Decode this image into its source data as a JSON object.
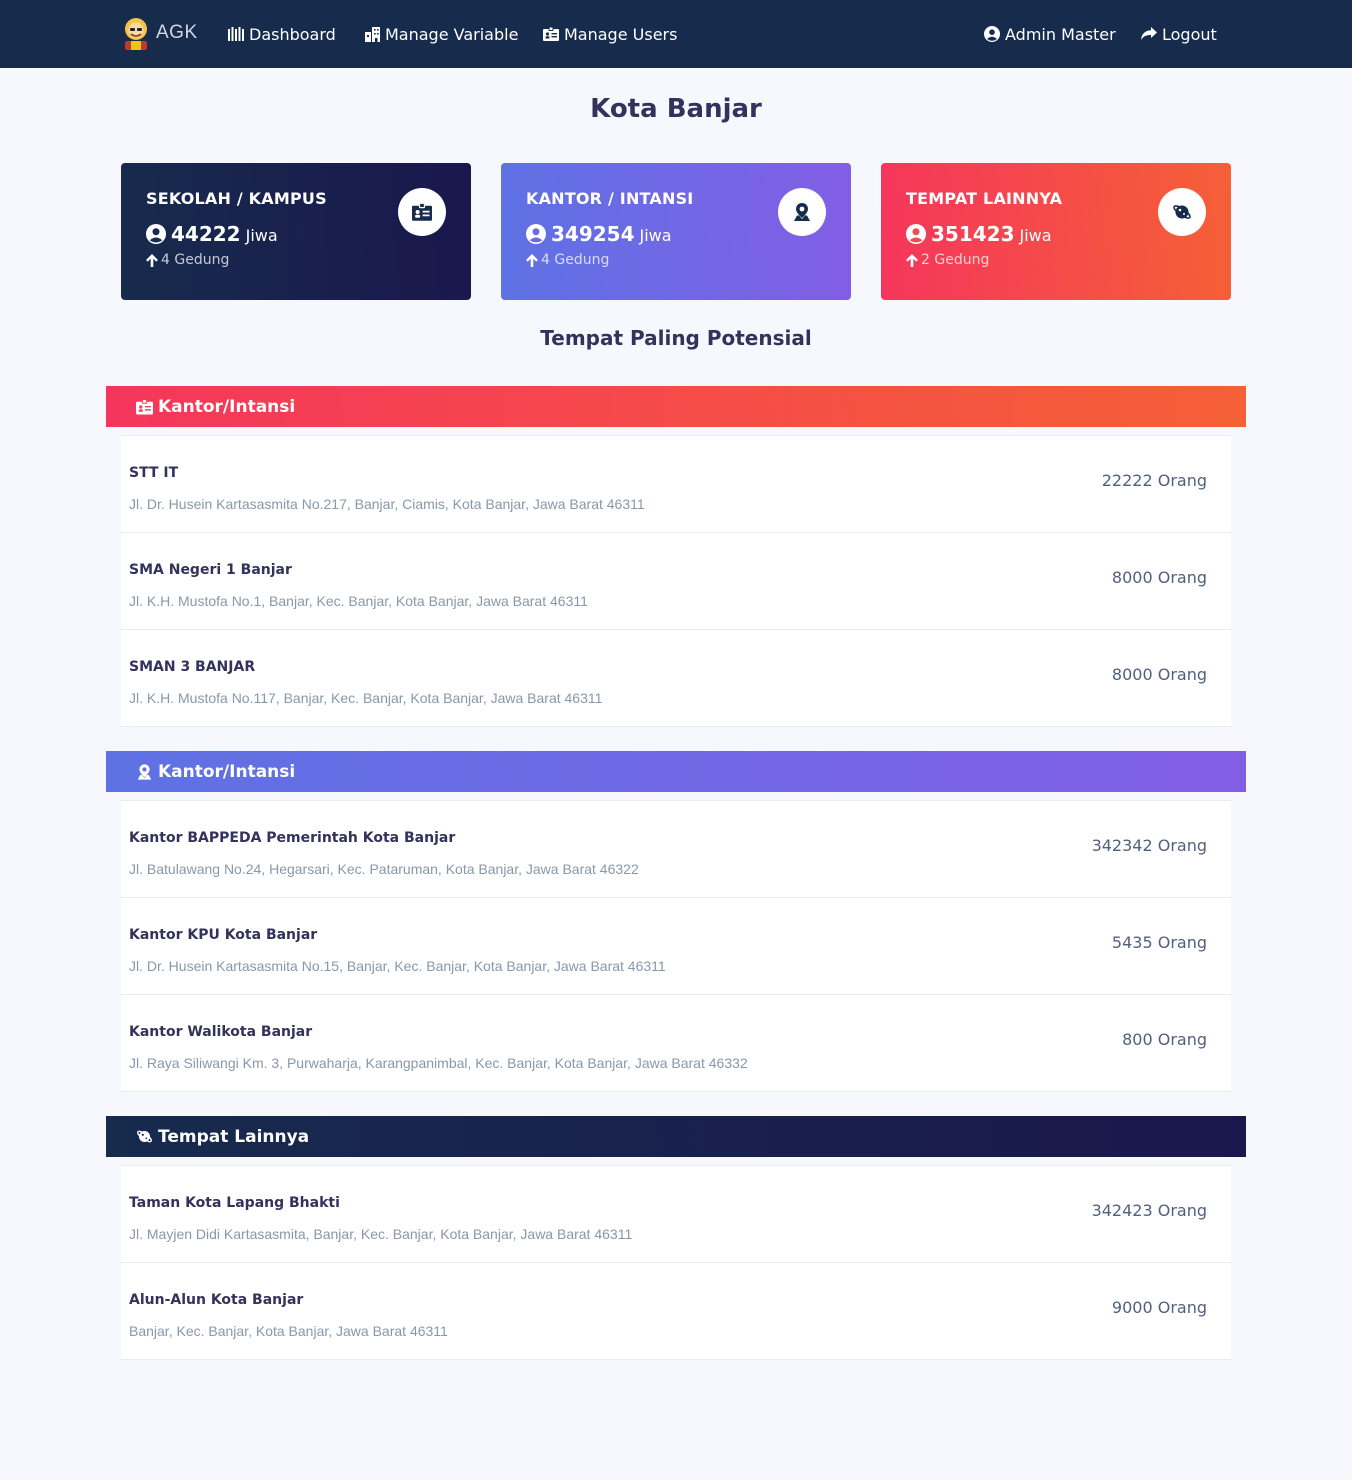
{
  "nav": {
    "brand": "AGK",
    "links": [
      {
        "label": "Dashboard",
        "icon": "chart-bars-icon"
      },
      {
        "label": "Manage Variable",
        "icon": "building-icon"
      },
      {
        "label": "Manage Users",
        "icon": "badge-icon"
      }
    ],
    "user": "Admin Master",
    "logout": "Logout"
  },
  "page_title": "Kota Banjar",
  "stats": [
    {
      "title": "SEKOLAH / KAMPUS",
      "value": "44222",
      "unit": "Jiwa",
      "sub": "4 Gedung",
      "icon": "badge-icon"
    },
    {
      "title": "KANTOR / INTANSI",
      "value": "349254",
      "unit": "Jiwa",
      "sub": "4 Gedung",
      "icon": "map-pin-icon"
    },
    {
      "title": "TEMPAT LAINNYA",
      "value": "351423",
      "unit": "Jiwa",
      "sub": "2 Gedung",
      "icon": "planet-icon"
    }
  ],
  "section_heading": "Tempat Paling Potensial",
  "groups": [
    {
      "title": "Kantor/Intansi",
      "icon": "badge-icon",
      "items": [
        {
          "name": "STT IT",
          "address": "Jl. Dr. Husein Kartasasmita No.217, Banjar, Ciamis, Kota Banjar, Jawa Barat 46311",
          "count": "22222 Orang"
        },
        {
          "name": "SMA Negeri 1 Banjar",
          "address": "Jl. K.H. Mustofa No.1, Banjar, Kec. Banjar, Kota Banjar, Jawa Barat 46311",
          "count": "8000 Orang"
        },
        {
          "name": "SMAN 3 BANJAR",
          "address": "Jl. K.H. Mustofa No.117, Banjar, Kec. Banjar, Kota Banjar, Jawa Barat 46311",
          "count": "8000 Orang"
        }
      ]
    },
    {
      "title": "Kantor/Intansi",
      "icon": "map-pin-icon",
      "items": [
        {
          "name": "Kantor BAPPEDA Pemerintah Kota Banjar",
          "address": "Jl. Batulawang No.24, Hegarsari, Kec. Pataruman, Kota Banjar, Jawa Barat 46322",
          "count": "342342 Orang"
        },
        {
          "name": "Kantor KPU Kota Banjar",
          "address": "Jl. Dr. Husein Kartasasmita No.15, Banjar, Kec. Banjar, Kota Banjar, Jawa Barat 46311",
          "count": "5435 Orang"
        },
        {
          "name": "Kantor Walikota Banjar",
          "address": "Jl. Raya Siliwangi Km. 3, Purwaharja, Karangpanimbal, Kec. Banjar, Kota Banjar, Jawa Barat 46332",
          "count": "800 Orang"
        }
      ]
    },
    {
      "title": "Tempat Lainnya",
      "icon": "planet-icon",
      "items": [
        {
          "name": "Taman Kota Lapang Bhakti",
          "address": "Jl. Mayjen Didi Kartasasmita, Banjar, Kec. Banjar, Kota Banjar, Jawa Barat 46311",
          "count": "342423 Orang"
        },
        {
          "name": "Alun-Alun Kota Banjar",
          "address": "Banjar, Kec. Banjar, Kota Banjar, Jawa Barat 46311",
          "count": "9000 Orang"
        }
      ]
    }
  ]
}
